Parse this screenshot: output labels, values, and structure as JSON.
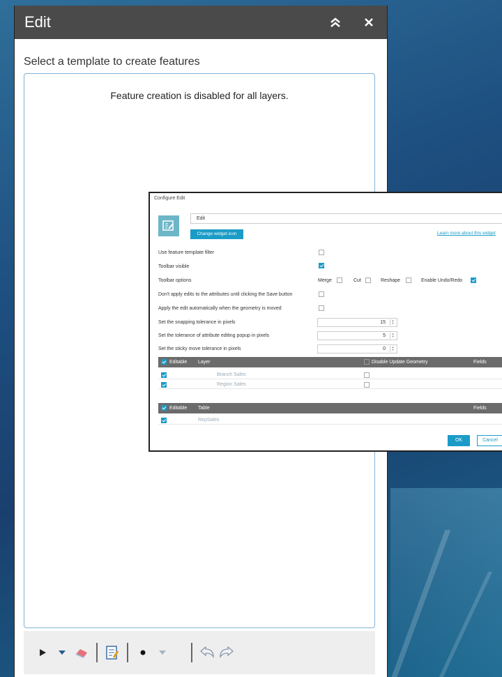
{
  "edit_panel": {
    "title": "Edit",
    "prompt": "Select a template to create features",
    "message": "Feature creation is disabled for all layers."
  },
  "icons": {
    "collapse": "double-chevron-up-icon",
    "close": "close-icon",
    "select": "select-arrow-icon",
    "eraser": "eraser-icon",
    "attributes": "attribute-table-icon",
    "point": "point-icon",
    "undo": "undo-icon",
    "redo": "redo-icon"
  },
  "dialog": {
    "title": "Configure Edit",
    "widget_name": "Edit",
    "change_icon_label": "Change widget icon",
    "learn_more": "Learn more about this widget",
    "settings": {
      "template_filter": "Use feature template filter",
      "toolbar_visible": "Toolbar visible",
      "toolbar_options": "Toolbar options",
      "dont_apply": "Don't apply edits to the attributes until clicking the Save button",
      "apply_auto": "Apply the edit automatically when the geometry is moved",
      "snapping": "Set the snapping tolerance in pixels",
      "popup_tol": "Set the tolerance of attribute editing popup in pixels",
      "sticky": "Set the sticky move tolerance in pixels"
    },
    "toolbar_opts": {
      "merge": "Merge",
      "cut": "Cut",
      "reshape": "Reshape",
      "undo_redo": "Enable Undo/Redo"
    },
    "values": {
      "snapping": "15",
      "popup_tol": "5",
      "sticky": "0"
    },
    "layer_table": {
      "col_editable": "Editable",
      "col_layer": "Layer",
      "col_disable_geom": "Disable Update Geometry",
      "col_fields": "Fields",
      "rows": [
        "Branch Sales",
        "Region Sales"
      ]
    },
    "table_table": {
      "col_editable": "Editable",
      "col_table": "Table",
      "col_fields": "Fields",
      "rows": [
        "RepSales"
      ]
    },
    "ok": "OK",
    "cancel": "Cancel"
  },
  "colors": {
    "accent": "#1b9cc7",
    "header": "#4a4a4a"
  }
}
